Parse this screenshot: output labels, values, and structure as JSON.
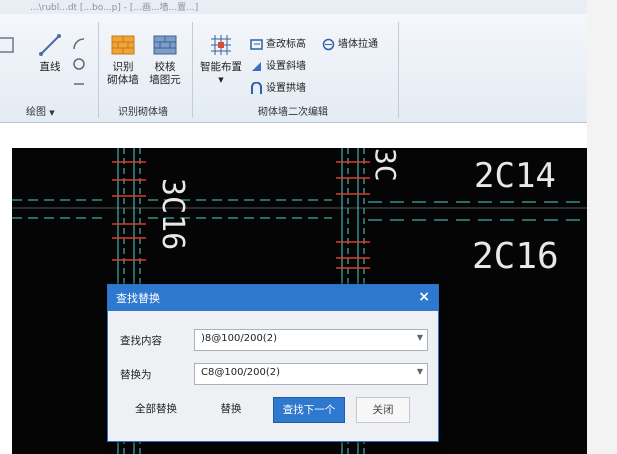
{
  "window": {
    "title_blurred": "...\\rubl...dt [...bo...p] - [...画...墙...置...]"
  },
  "ribbon": {
    "draw_group": {
      "label": "绘图",
      "straight_line": "直线"
    },
    "identify_group": {
      "label": "识别砌体墙",
      "identify_line1": "识别",
      "identify_line2": "砌体墙",
      "check_line1": "校核",
      "check_line2": "墙图元"
    },
    "edit_group": {
      "label": "砌体墙二次编辑",
      "smart_layout": "智能布置",
      "check_elevation": "查改标高",
      "wall_extend": "墙体拉通",
      "set_slope_wall": "设置斜墙",
      "set_arch_wall": "设置拱墙"
    }
  },
  "canvas": {
    "labels": [
      "3C16",
      "3C",
      "2C14",
      "2C16"
    ],
    "colors": {
      "background": "#050505",
      "line_cyan": "#4fd3d3",
      "line_red": "#e23a2a",
      "text": "#e8e8e8"
    }
  },
  "dialog": {
    "title": "查找替换",
    "find_label": "查找内容",
    "find_value": ")8@100/200(2)",
    "replace_label": "替换为",
    "replace_value": "C8@100/200(2)",
    "buttons": {
      "replace_all": "全部替换",
      "replace": "替换",
      "find_next": "查找下一个",
      "close": "关闭"
    },
    "close_glyph": "×"
  }
}
